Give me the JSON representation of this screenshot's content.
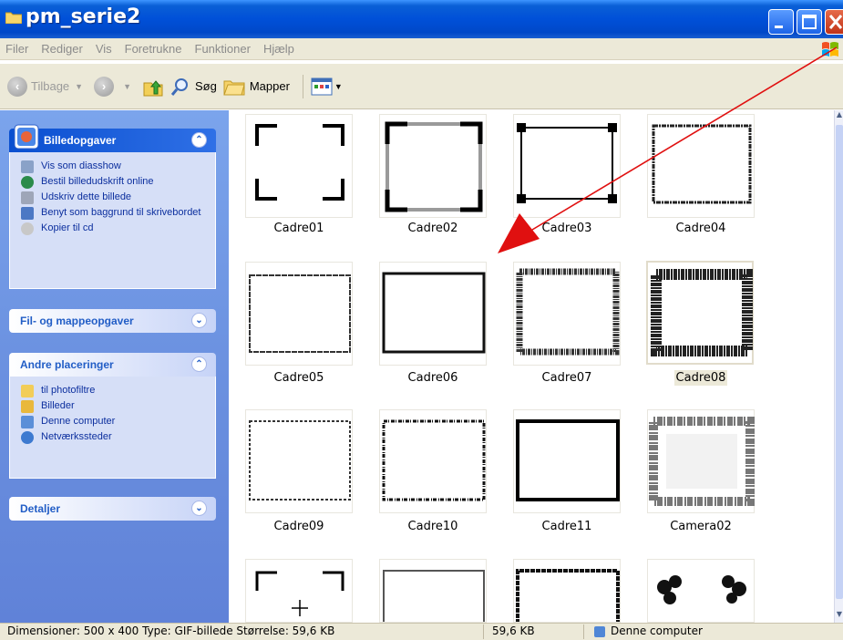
{
  "window": {
    "title": "pm_serie2"
  },
  "menu": [
    "Filer",
    "Rediger",
    "Vis",
    "Foretrukne",
    "Funktioner",
    "Hjælp"
  ],
  "toolbar": {
    "back_label": "Tilbage",
    "search_label": "Søg",
    "folders_label": "Mapper"
  },
  "left_pane": {
    "picture_tasks": {
      "title": "Billedopgaver",
      "items": [
        "Vis som diasshow",
        "Bestil billedudskrift online",
        "Udskriv dette billede",
        "Benyt som baggrund til skrivebordet",
        "Kopier til cd"
      ]
    },
    "file_tasks": {
      "title": "Fil- og mappeopgaver"
    },
    "other_places": {
      "title": "Andre placeringer",
      "items": [
        "til photofiltre",
        "Billeder",
        "Denne computer",
        "Netværkssteder"
      ]
    },
    "details": {
      "title": "Detaljer"
    }
  },
  "files": [
    {
      "name": "Cadre01"
    },
    {
      "name": "Cadre02"
    },
    {
      "name": "Cadre03"
    },
    {
      "name": "Cadre04"
    },
    {
      "name": "Cadre05"
    },
    {
      "name": "Cadre06"
    },
    {
      "name": "Cadre07"
    },
    {
      "name": "Cadre08",
      "selected": true
    },
    {
      "name": "Cadre09"
    },
    {
      "name": "Cadre10"
    },
    {
      "name": "Cadre11"
    },
    {
      "name": "Camera02"
    }
  ],
  "status": {
    "info": "Dimensioner: 500 x 400 Type: GIF-billede Størrelse: 59,6 KB",
    "size": "59,6 KB",
    "location": "Denne computer"
  },
  "colors": {
    "title_bar": "#0050d8",
    "task_pane": "#6b91e0",
    "annotation_arrow": "#e01010"
  }
}
